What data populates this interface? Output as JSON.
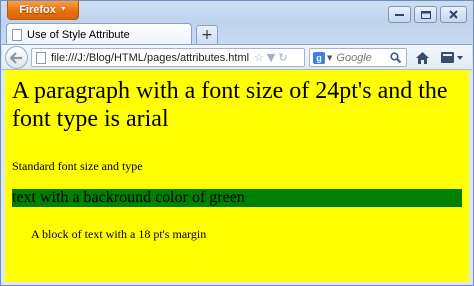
{
  "browser": {
    "menu_button_label": "Firefox",
    "tab_title": "Use of Style Attribute",
    "new_tab_label": "+",
    "url": "file:///J:/Blog/HTML/pages/attributes.html",
    "search_engine": "Google",
    "search_placeholder": "Google"
  },
  "page": {
    "background_color": "#ffff00",
    "paragraph_large": "A paragraph with a font size of 24pt's and the font type is arial",
    "paragraph_standard": "Standard font size and type",
    "paragraph_green": "text with a backround color of green",
    "paragraph_green_bg": "#008000",
    "paragraph_margin": "A block of text with a 18 pt's margin"
  },
  "icons": {
    "back": "back-arrow-icon",
    "home": "home-icon",
    "search": "magnifier-icon",
    "bookmark": "star-icon",
    "reload": "reload-icon",
    "menu": "bookmarks-menu-icon",
    "minimize": "minimize-icon",
    "maximize": "maximize-icon",
    "close": "close-icon"
  }
}
